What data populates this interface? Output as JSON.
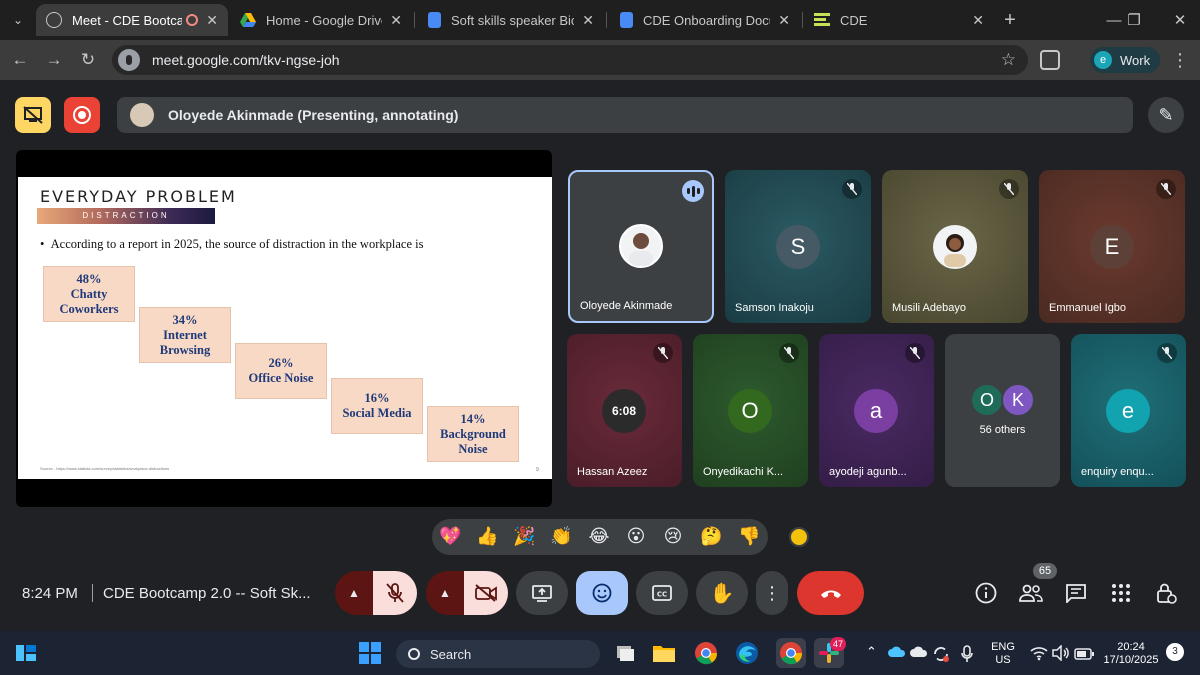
{
  "browser": {
    "tabs": [
      {
        "title": "Meet - CDE Bootcamp",
        "active": true
      },
      {
        "title": "Home - Google Drive",
        "active": false
      },
      {
        "title": "Soft skills speaker Bio - G",
        "active": false
      },
      {
        "title": "CDE Onboarding Docum",
        "active": false
      },
      {
        "title": "CDE",
        "active": false
      }
    ],
    "url": "meet.google.com/tkv-ngse-joh",
    "profile_initial": "e",
    "profile_label": "Work"
  },
  "meet": {
    "presenter_text": "Oloyede Akinmade (Presenting, annotating)",
    "time": "8:24 PM",
    "meeting_title": "CDE Bootcamp 2.0 -- Soft Sk...",
    "people_count": "65"
  },
  "slide": {
    "title": "EVERYDAY PROBLEM",
    "band_label": "DISTRACTION",
    "bullet": "According to a report in 2025, the source of distraction in the workplace is",
    "stats": [
      {
        "lines": [
          "48%",
          "Chatty",
          "Coworkers"
        ],
        "value": 48
      },
      {
        "lines": [
          "34%",
          "Internet",
          "Browsing"
        ],
        "value": 34
      },
      {
        "lines": [
          "26%",
          "Office Noise"
        ],
        "value": 26
      },
      {
        "lines": [
          "16%",
          "Social Media"
        ],
        "value": 16
      },
      {
        "lines": [
          "14%",
          "Background",
          "Noise"
        ],
        "value": 14
      }
    ],
    "source": "Source - https://www.statista.com/survey/statistics/workplace-distractions"
  },
  "participants": [
    {
      "name": "Oloyede Akinmade",
      "initial": "",
      "speaking": true,
      "muted": false
    },
    {
      "name": "Samson Inakoju",
      "initial": "S",
      "speaking": false,
      "muted": true
    },
    {
      "name": "Musili Adebayo",
      "initial": "",
      "speaking": false,
      "muted": true
    },
    {
      "name": "Emmanuel Igbo",
      "initial": "E",
      "speaking": false,
      "muted": true
    },
    {
      "name": "Hassan Azeez",
      "initial": "6:08",
      "speaking": false,
      "muted": true
    },
    {
      "name": "Onyedikachi K...",
      "initial": "O",
      "speaking": false,
      "muted": true
    },
    {
      "name": "ayodeji agunb...",
      "initial": "a",
      "speaking": false,
      "muted": true
    },
    {
      "name": "enquiry enqu...",
      "initial": "e",
      "speaking": false,
      "muted": true
    }
  ],
  "others": {
    "label": "56 others",
    "initials": [
      "O",
      "K"
    ]
  },
  "reactions": [
    "💖",
    "👍",
    "🎉",
    "👏",
    "😂",
    "😮",
    "😢",
    "🤔",
    "👎"
  ],
  "taskbar": {
    "search_label": "Search",
    "lang_line1": "ENG",
    "lang_line2": "US",
    "clock_time": "20:24",
    "clock_date": "17/10/2025",
    "notification_count": "3",
    "app_badge": "47"
  }
}
